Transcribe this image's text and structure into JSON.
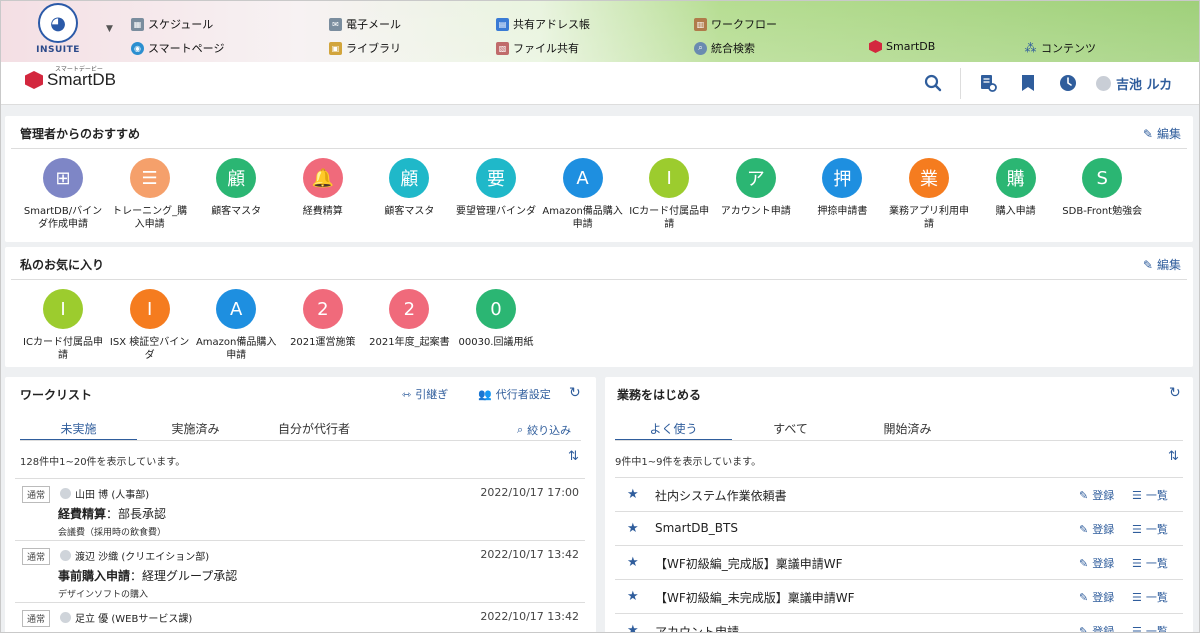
{
  "portal": {
    "logo_text": "INSUITE",
    "menu": [
      {
        "label": "スケジュール",
        "icon": "calendar-icon",
        "color": "#7a8d9e"
      },
      {
        "label": "電子メール",
        "icon": "mail-icon",
        "color": "#7a8d9e"
      },
      {
        "label": "共有アドレス帳",
        "icon": "address-book-icon",
        "color": "#3a7bd5"
      },
      {
        "label": "ワークフロー",
        "icon": "workflow-icon",
        "color": "#b07b4a"
      },
      {
        "label": "スマートページ",
        "icon": "smartpage-icon",
        "color": "#2b8fd0"
      },
      {
        "label": "ライブラリ",
        "icon": "library-icon",
        "color": "#d2a53c"
      },
      {
        "label": "ファイル共有",
        "icon": "file-share-icon",
        "color": "#c06b6b"
      },
      {
        "label": "統合検索",
        "icon": "search-icon",
        "color": "#6a8bb0"
      },
      {
        "label": "SmartDB",
        "icon": "smartdb-icon",
        "color": "#d3273e"
      },
      {
        "label": "コンテンツ",
        "icon": "contents-icon",
        "color": "#2f5d9c"
      }
    ]
  },
  "header": {
    "brand": "SmartDB",
    "brand_ruby": "スマートデービー",
    "user_name": "吉池 ルカ"
  },
  "recommend": {
    "title": "管理者からのおすすめ",
    "edit_label": "編集",
    "apps": [
      {
        "glyph": "⊞",
        "label": "SmartDB/バインダ作成申請",
        "color": "#7e86c6"
      },
      {
        "glyph": "☰",
        "label": "トレーニング_購入申請",
        "color": "#f5a06b"
      },
      {
        "glyph": "顧",
        "label": "顧客マスタ",
        "color": "#2bb673"
      },
      {
        "glyph": "🔔",
        "label": "経費精算",
        "color": "#f06a7b"
      },
      {
        "glyph": "顧",
        "label": "顧客マスタ",
        "color": "#1fb8c9"
      },
      {
        "glyph": "要",
        "label": "要望管理バインダ",
        "color": "#1fb8c9"
      },
      {
        "glyph": "A",
        "label": "Amazon備品購入申請",
        "color": "#1e8fe0"
      },
      {
        "glyph": "I",
        "label": "ICカード付属品申請",
        "color": "#9ccc2e"
      },
      {
        "glyph": "ア",
        "label": "アカウント申請",
        "color": "#2bb673"
      },
      {
        "glyph": "押",
        "label": "押捺申請書",
        "color": "#1e8fe0"
      },
      {
        "glyph": "業",
        "label": "業務アプリ利用申請",
        "color": "#f57c1f"
      },
      {
        "glyph": "購",
        "label": "購入申請",
        "color": "#2bb673"
      },
      {
        "glyph": "S",
        "label": "SDB-Front勉強会",
        "color": "#2bb673"
      }
    ]
  },
  "favorites": {
    "title": "私のお気に入り",
    "edit_label": "編集",
    "apps": [
      {
        "glyph": "I",
        "label": "ICカード付属品申請",
        "color": "#9ccc2e"
      },
      {
        "glyph": "I",
        "label": "ISX 検証空バインダ",
        "color": "#f57c1f"
      },
      {
        "glyph": "A",
        "label": "Amazon備品購入申請",
        "color": "#1e8fe0"
      },
      {
        "glyph": "2",
        "label": "2021運営施策",
        "color": "#f06a7b"
      },
      {
        "glyph": "2",
        "label": "2021年度_起案書",
        "color": "#f06a7b"
      },
      {
        "glyph": "0",
        "label": "00030.回議用紙",
        "color": "#2bb673"
      }
    ]
  },
  "worklist": {
    "title": "ワークリスト",
    "handover": "引継ぎ",
    "delegate": "代行者設定",
    "tabs": [
      "未実施",
      "実施済み",
      "自分が代行者"
    ],
    "filter": "絞り込み",
    "count": "128件中1~20件を表示しています。",
    "rows": [
      {
        "badge": "通常",
        "user": "山田 博 (人事部)",
        "date": "2022/10/17 17:00",
        "app": "経費精算",
        "step": "部長承認",
        "sub": "会議費（採用時の飲食費）"
      },
      {
        "badge": "通常",
        "user": "渡辺 沙織 (クリエイション部)",
        "date": "2022/10/17 13:42",
        "app": "事前購入申請",
        "step": "経理グループ承認",
        "sub": "デザインソフトの購入"
      },
      {
        "badge": "通常",
        "user": "足立 優 (WEBサービス課)",
        "date": "2022/10/17 13:42",
        "app": "",
        "step": "",
        "sub": ""
      }
    ]
  },
  "business": {
    "title": "業務をはじめる",
    "tabs": [
      "よく使う",
      "すべて",
      "開始済み"
    ],
    "count": "9件中1~9件を表示しています。",
    "register": "登録",
    "list": "一覧",
    "rows": [
      "社内システム作業依頼書",
      "SmartDB_BTS",
      "【WF初級編_完成版】稟議申請WF",
      "【WF初級編_未完成版】稟議申請WF",
      "アカウント申請"
    ]
  }
}
